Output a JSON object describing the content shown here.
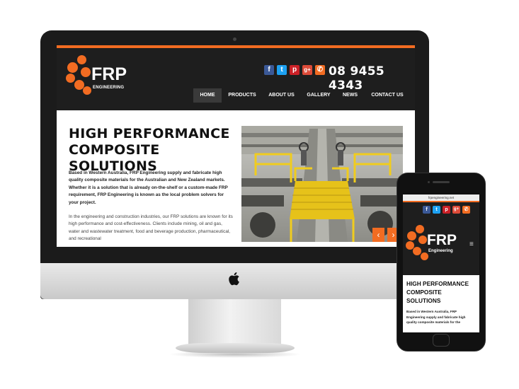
{
  "desktop": {
    "logo": {
      "title": "FRP",
      "subtitle": "ENGINEERING"
    },
    "social": {
      "facebook": "f",
      "twitter": "t",
      "pinterest": "p",
      "googleplus": "g+",
      "phone_icon": "✆"
    },
    "phone_number": "08 9455 4343",
    "nav": [
      "HOME",
      "PRODUCTS",
      "ABOUT US",
      "GALLERY",
      "NEWS",
      "CONTACT US"
    ],
    "hero": {
      "title_line1": "HIGH PERFORMANCE",
      "title_line2": "COMPOSITE SOLUTIONS",
      "paragraph1": "Based in Western Australia, FRP Engineering supply and fabricate high quality composite materials for the Australian and New Zealand markets. Whether it is a solution that is already on-the-shelf or a custom-made FRP requirement, FRP Engineering is known as the local problem solvers for your project.",
      "paragraph2": "In the engineering and construction industries, our FRP solutions are known for its high performance and cost-effectiveness. Clients include mining, oil and gas, water and wastewater treatment, food and beverage production, pharmaceutical, and recreational"
    },
    "slider": {
      "prev": "‹",
      "next": "›"
    }
  },
  "mobile": {
    "url": "frpengineering.net",
    "logo": {
      "title": "FRP",
      "subtitle": "Engineering"
    },
    "menu_icon": "≡",
    "title_line1": "HIGH PERFORMANCE",
    "title_line2": "COMPOSITE",
    "title_line3": "SOLUTIONS",
    "paragraph": "Based in Western Australia, FRP Engineering supply and fabricate high quality composite materials for the"
  },
  "colors": {
    "accent": "#f26c22",
    "header_bg": "#1e1e1e",
    "facebook": "#3b5998",
    "twitter": "#1da1f2",
    "pinterest": "#cb2027",
    "googleplus": "#dd4b39",
    "phone": "#f26c22"
  }
}
